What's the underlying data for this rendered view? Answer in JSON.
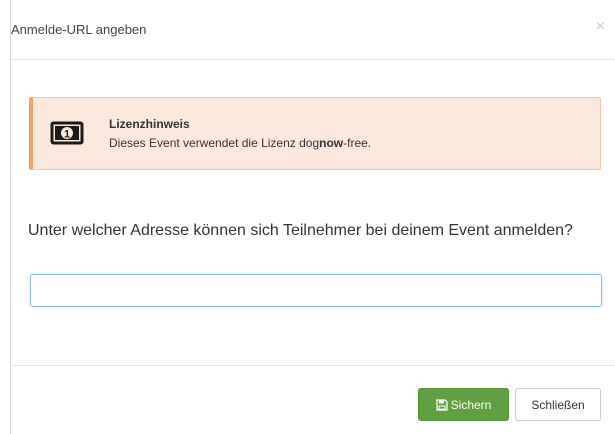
{
  "dialog": {
    "title": "Anmelde-URL angeben",
    "close_symbol": "×"
  },
  "license_notice": {
    "icon": "money-bill-icon",
    "title": "Lizenzhinweis",
    "text_prefix": "Dieses Event verwendet die Lizenz dog",
    "text_bold": "now",
    "text_suffix": "-free."
  },
  "form": {
    "question": "Unter welcher Adresse können sich Teilnehmer bei deinem Event anmelden?",
    "url_value": ""
  },
  "footer": {
    "save_label": "Sichern",
    "close_label": "Schließen"
  },
  "colors": {
    "alert_background": "#fce9dd",
    "alert_accent": "#f5a06a",
    "save_button": "#5fa042",
    "input_focus_border": "#8cb8e6"
  }
}
